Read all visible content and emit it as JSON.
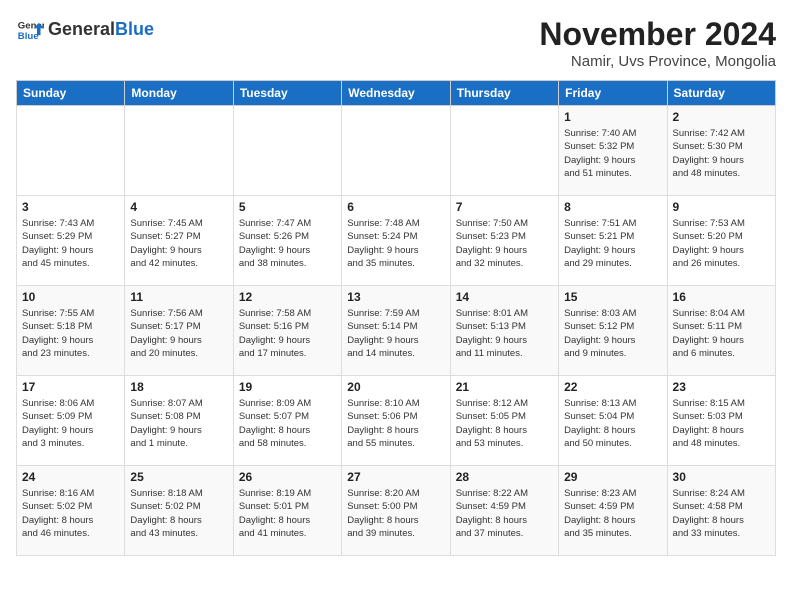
{
  "header": {
    "logo_line1": "General",
    "logo_line2": "Blue",
    "month_year": "November 2024",
    "location": "Namir, Uvs Province, Mongolia"
  },
  "weekdays": [
    "Sunday",
    "Monday",
    "Tuesday",
    "Wednesday",
    "Thursday",
    "Friday",
    "Saturday"
  ],
  "weeks": [
    [
      {
        "day": "",
        "info": ""
      },
      {
        "day": "",
        "info": ""
      },
      {
        "day": "",
        "info": ""
      },
      {
        "day": "",
        "info": ""
      },
      {
        "day": "",
        "info": ""
      },
      {
        "day": "1",
        "info": "Sunrise: 7:40 AM\nSunset: 5:32 PM\nDaylight: 9 hours\nand 51 minutes."
      },
      {
        "day": "2",
        "info": "Sunrise: 7:42 AM\nSunset: 5:30 PM\nDaylight: 9 hours\nand 48 minutes."
      }
    ],
    [
      {
        "day": "3",
        "info": "Sunrise: 7:43 AM\nSunset: 5:29 PM\nDaylight: 9 hours\nand 45 minutes."
      },
      {
        "day": "4",
        "info": "Sunrise: 7:45 AM\nSunset: 5:27 PM\nDaylight: 9 hours\nand 42 minutes."
      },
      {
        "day": "5",
        "info": "Sunrise: 7:47 AM\nSunset: 5:26 PM\nDaylight: 9 hours\nand 38 minutes."
      },
      {
        "day": "6",
        "info": "Sunrise: 7:48 AM\nSunset: 5:24 PM\nDaylight: 9 hours\nand 35 minutes."
      },
      {
        "day": "7",
        "info": "Sunrise: 7:50 AM\nSunset: 5:23 PM\nDaylight: 9 hours\nand 32 minutes."
      },
      {
        "day": "8",
        "info": "Sunrise: 7:51 AM\nSunset: 5:21 PM\nDaylight: 9 hours\nand 29 minutes."
      },
      {
        "day": "9",
        "info": "Sunrise: 7:53 AM\nSunset: 5:20 PM\nDaylight: 9 hours\nand 26 minutes."
      }
    ],
    [
      {
        "day": "10",
        "info": "Sunrise: 7:55 AM\nSunset: 5:18 PM\nDaylight: 9 hours\nand 23 minutes."
      },
      {
        "day": "11",
        "info": "Sunrise: 7:56 AM\nSunset: 5:17 PM\nDaylight: 9 hours\nand 20 minutes."
      },
      {
        "day": "12",
        "info": "Sunrise: 7:58 AM\nSunset: 5:16 PM\nDaylight: 9 hours\nand 17 minutes."
      },
      {
        "day": "13",
        "info": "Sunrise: 7:59 AM\nSunset: 5:14 PM\nDaylight: 9 hours\nand 14 minutes."
      },
      {
        "day": "14",
        "info": "Sunrise: 8:01 AM\nSunset: 5:13 PM\nDaylight: 9 hours\nand 11 minutes."
      },
      {
        "day": "15",
        "info": "Sunrise: 8:03 AM\nSunset: 5:12 PM\nDaylight: 9 hours\nand 9 minutes."
      },
      {
        "day": "16",
        "info": "Sunrise: 8:04 AM\nSunset: 5:11 PM\nDaylight: 9 hours\nand 6 minutes."
      }
    ],
    [
      {
        "day": "17",
        "info": "Sunrise: 8:06 AM\nSunset: 5:09 PM\nDaylight: 9 hours\nand 3 minutes."
      },
      {
        "day": "18",
        "info": "Sunrise: 8:07 AM\nSunset: 5:08 PM\nDaylight: 9 hours\nand 1 minute."
      },
      {
        "day": "19",
        "info": "Sunrise: 8:09 AM\nSunset: 5:07 PM\nDaylight: 8 hours\nand 58 minutes."
      },
      {
        "day": "20",
        "info": "Sunrise: 8:10 AM\nSunset: 5:06 PM\nDaylight: 8 hours\nand 55 minutes."
      },
      {
        "day": "21",
        "info": "Sunrise: 8:12 AM\nSunset: 5:05 PM\nDaylight: 8 hours\nand 53 minutes."
      },
      {
        "day": "22",
        "info": "Sunrise: 8:13 AM\nSunset: 5:04 PM\nDaylight: 8 hours\nand 50 minutes."
      },
      {
        "day": "23",
        "info": "Sunrise: 8:15 AM\nSunset: 5:03 PM\nDaylight: 8 hours\nand 48 minutes."
      }
    ],
    [
      {
        "day": "24",
        "info": "Sunrise: 8:16 AM\nSunset: 5:02 PM\nDaylight: 8 hours\nand 46 minutes."
      },
      {
        "day": "25",
        "info": "Sunrise: 8:18 AM\nSunset: 5:02 PM\nDaylight: 8 hours\nand 43 minutes."
      },
      {
        "day": "26",
        "info": "Sunrise: 8:19 AM\nSunset: 5:01 PM\nDaylight: 8 hours\nand 41 minutes."
      },
      {
        "day": "27",
        "info": "Sunrise: 8:20 AM\nSunset: 5:00 PM\nDaylight: 8 hours\nand 39 minutes."
      },
      {
        "day": "28",
        "info": "Sunrise: 8:22 AM\nSunset: 4:59 PM\nDaylight: 8 hours\nand 37 minutes."
      },
      {
        "day": "29",
        "info": "Sunrise: 8:23 AM\nSunset: 4:59 PM\nDaylight: 8 hours\nand 35 minutes."
      },
      {
        "day": "30",
        "info": "Sunrise: 8:24 AM\nSunset: 4:58 PM\nDaylight: 8 hours\nand 33 minutes."
      }
    ]
  ]
}
